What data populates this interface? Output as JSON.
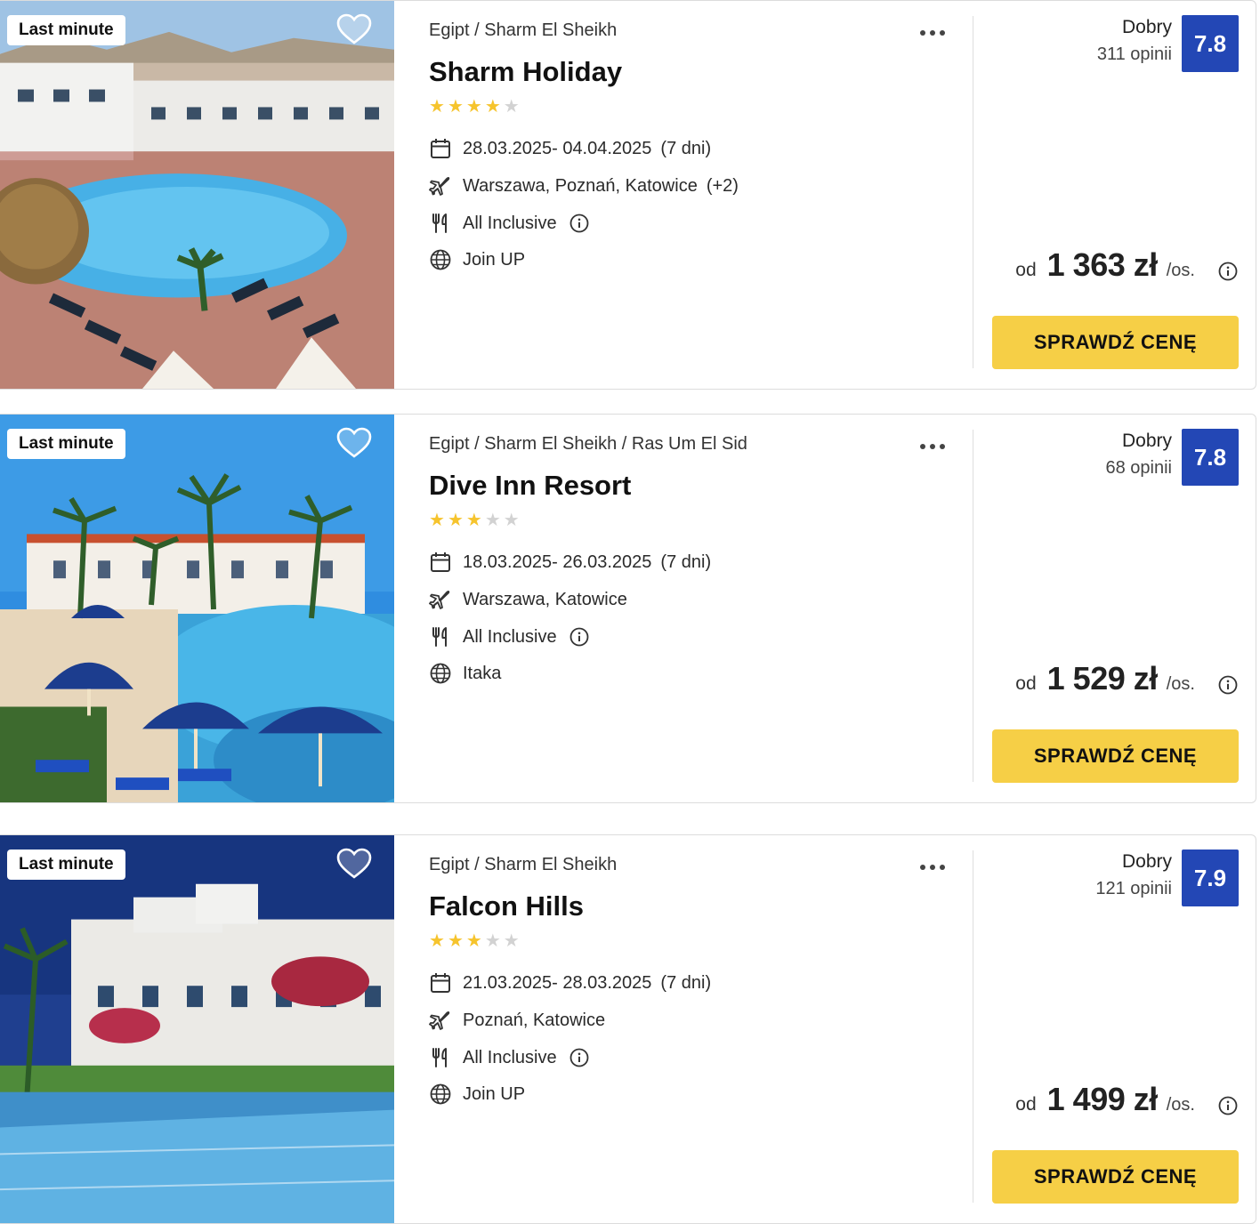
{
  "offers": [
    {
      "badge": "Last minute",
      "location": "Egipt / Sharm El Sheikh",
      "name": "Sharm Holiday",
      "stars": 4,
      "dates": "28.03.2025- 04.04.2025",
      "duration": "(7 dni)",
      "departures": "Warszawa, Poznań, Katowice",
      "departures_extra": "(+2)",
      "board": "All Inclusive",
      "operator": "Join UP",
      "rating_word": "Dobry",
      "rating_count": "311 opinii",
      "rating_score": "7.8",
      "price_prefix": "od",
      "price": "1 363 zł",
      "price_suffix": "/os.",
      "cta": "SPRAWDŹ CENĘ"
    },
    {
      "badge": "Last minute",
      "location": "Egipt / Sharm El Sheikh / Ras Um El Sid",
      "name": "Dive Inn Resort",
      "stars": 3,
      "dates": "18.03.2025- 26.03.2025",
      "duration": "(7 dni)",
      "departures": "Warszawa, Katowice",
      "departures_extra": "",
      "board": "All Inclusive",
      "operator": "Itaka",
      "rating_word": "Dobry",
      "rating_count": "68 opinii",
      "rating_score": "7.8",
      "price_prefix": "od",
      "price": "1 529 zł",
      "price_suffix": "/os.",
      "cta": "SPRAWDŹ CENĘ"
    },
    {
      "badge": "Last minute",
      "location": "Egipt / Sharm El Sheikh",
      "name": "Falcon Hills",
      "stars": 3,
      "dates": "21.03.2025- 28.03.2025",
      "duration": "(7 dni)",
      "departures": "Poznań, Katowice",
      "departures_extra": "",
      "board": "All Inclusive",
      "operator": "Join UP",
      "rating_word": "Dobry",
      "rating_count": "121 opinii",
      "rating_score": "7.9",
      "price_prefix": "od",
      "price": "1 499 zł",
      "price_suffix": "/os.",
      "cta": "SPRAWDŹ CENĘ"
    }
  ],
  "colors": {
    "score_bg": "#2347b5",
    "cta_bg": "#f6cf46",
    "star_on": "#f6c42d",
    "star_off": "#d2d2d2"
  }
}
